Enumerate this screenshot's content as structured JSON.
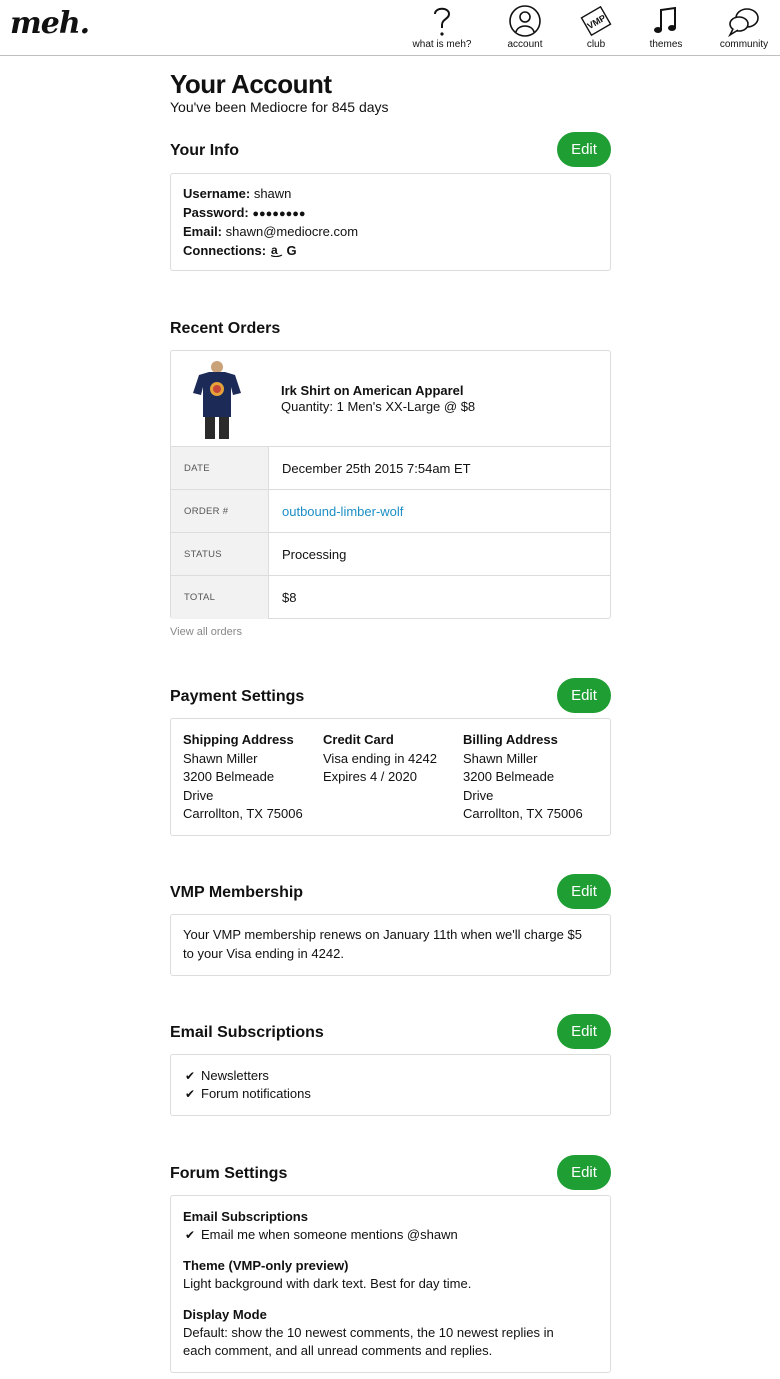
{
  "header": {
    "logo": "meh.",
    "nav": [
      {
        "icon": "question-icon",
        "label": "what is meh?"
      },
      {
        "icon": "user-icon",
        "label": "account"
      },
      {
        "icon": "vmp-icon",
        "label": "club"
      },
      {
        "icon": "music-note-icon",
        "label": "themes"
      },
      {
        "icon": "chat-icon",
        "label": "community"
      }
    ],
    "vmp_badge": "VMP"
  },
  "page": {
    "title": "Your Account",
    "subtitle": "You've been Mediocre for 845 days"
  },
  "edit_label": "Edit",
  "your_info": {
    "title": "Your Info",
    "username_label": "Username:",
    "username": "shawn",
    "password_label": "Password:",
    "password": "●●●●●●●●",
    "email_label": "Email:",
    "email": "shawn@mediocre.com",
    "connections_label": "Connections:",
    "connections": [
      "amazon-icon",
      "google-icon"
    ]
  },
  "recent_orders": {
    "title": "Recent Orders",
    "product": "Irk Shirt on American Apparel",
    "quantity": "Quantity: 1 Men's XX-Large @ $8",
    "rows": [
      {
        "label": "DATE",
        "value": "December 25th 2015 7:54am ET"
      },
      {
        "label": "ORDER #",
        "value": "outbound-limber-wolf"
      },
      {
        "label": "STATUS",
        "value": "Processing"
      },
      {
        "label": "TOTAL",
        "value": "$8"
      }
    ],
    "view_all": "View all orders"
  },
  "payment": {
    "title": "Payment Settings",
    "shipping": {
      "title": "Shipping Address",
      "name": "Shawn Miller",
      "street1": "3200 Belmeade",
      "street2": "Drive",
      "city": "Carrollton, TX 75006"
    },
    "card": {
      "title": "Credit Card",
      "line1": "Visa ending in 4242",
      "line2": "Expires 4 / 2020"
    },
    "billing": {
      "title": "Billing Address",
      "name": "Shawn Miller",
      "street1": "3200 Belmeade",
      "street2": "Drive",
      "city": "Carrollton, TX 75006"
    }
  },
  "vmp": {
    "title": "VMP Membership",
    "line1": "Your VMP membership renews on January 11th when we'll charge $5",
    "line2": "to your Visa ending in 4242."
  },
  "email_subs": {
    "title": "Email Subscriptions",
    "items": [
      "Newsletters",
      "Forum notifications"
    ]
  },
  "forum": {
    "title": "Forum Settings",
    "email_head": "Email Subscriptions",
    "email_item": "Email me when someone mentions @shawn",
    "theme_head": "Theme (VMP-only preview)",
    "theme_text": "Light background with dark text. Best for day time.",
    "display_head": "Display Mode",
    "display_line1": "Default: show the 10 newest comments, the 10 newest replies in",
    "display_line2": "each comment, and all unread comments and replies."
  },
  "colors": {
    "accent": "#1f9e34",
    "link": "#1b8fc4",
    "border": "#dcdcdc",
    "label_bg": "#f2f2f2"
  }
}
